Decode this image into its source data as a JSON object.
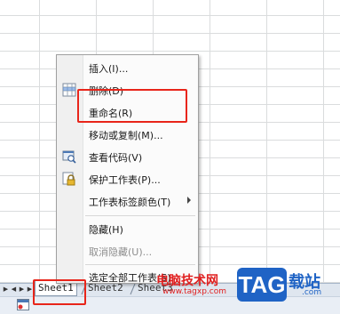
{
  "context_menu": {
    "items": [
      {
        "label": "插入(I)...",
        "icon": "",
        "enabled": true
      },
      {
        "label": "删除(D)",
        "icon": "delete-sheet-icon",
        "enabled": true
      },
      {
        "label": "重命名(R)",
        "icon": "",
        "enabled": true
      },
      {
        "label": "移动或复制(M)...",
        "icon": "",
        "enabled": true
      },
      {
        "label": "查看代码(V)",
        "icon": "view-code-icon",
        "enabled": true
      },
      {
        "label": "保护工作表(P)...",
        "icon": "protect-sheet-icon",
        "enabled": true
      },
      {
        "label": "工作表标签颜色(T)",
        "icon": "",
        "enabled": true,
        "submenu": true
      },
      {
        "label": "隐藏(H)",
        "icon": "",
        "enabled": true
      },
      {
        "label": "取消隐藏(U)...",
        "icon": "",
        "enabled": false
      },
      {
        "label": "选定全部工作表(S)",
        "icon": "",
        "enabled": true
      }
    ]
  },
  "sheet_tabs": [
    {
      "label": "Sheet1",
      "active": true
    },
    {
      "label": "Sheet2",
      "active": false
    },
    {
      "label": "Sheet3",
      "active": false
    }
  ],
  "watermark": {
    "text": "电脑技术网",
    "url": "www.tagxp.com",
    "tag": "TAG",
    "zhan": "载站",
    "com": ".com"
  },
  "colors": {
    "highlight": "#e8251a",
    "watermark_red": "#e02020",
    "watermark_blue": "#1f63c5"
  }
}
